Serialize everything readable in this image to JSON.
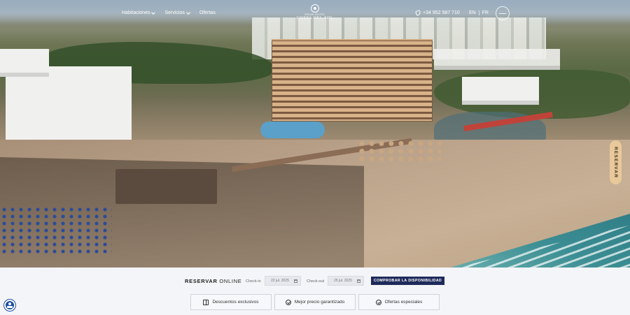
{
  "nav": {
    "items": [
      {
        "label": "Habitaciones",
        "has_dropdown": true
      },
      {
        "label": "Servicios",
        "has_dropdown": true
      },
      {
        "label": "Ofertas",
        "has_dropdown": false
      }
    ],
    "logo": {
      "small": "GRAN HOTEL",
      "big": "COSTA DEL SOL"
    },
    "phone": "+34 952 587 710",
    "languages": [
      "EN",
      "FR"
    ]
  },
  "hero": {
    "image": "aerial-beach-hotel-photo"
  },
  "side_tab": {
    "label": "RESERVAR"
  },
  "booking": {
    "title_bold": "RESERVAR",
    "title_light": "ONLINE",
    "checkin_label": "Check-in",
    "checkin_value": "22 jul. 2025",
    "checkout_label": "Check-out",
    "checkout_value": "25 jul. 2025",
    "check_button": "COMPROBAR LA DISPONIBILIDAD"
  },
  "perks": [
    {
      "label": "Descuentos exclusivos",
      "icon": "gift-icon"
    },
    {
      "label": "Mejor precio garantizado",
      "icon": "check-circle-icon"
    },
    {
      "label": "Ofertas especiales",
      "icon": "check-circle-icon"
    }
  ],
  "colors": {
    "primary": "#1e2a5a",
    "accent_tab": "#e9c99a",
    "background": "#f4f5f8"
  },
  "accessibility": {
    "icon": "accessibility-icon"
  }
}
